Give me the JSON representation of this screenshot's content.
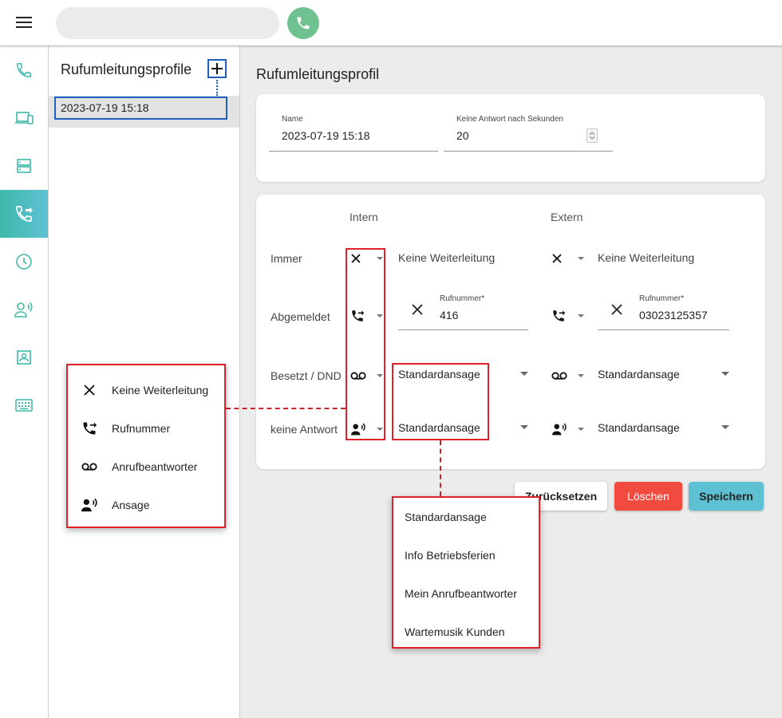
{
  "search": {
    "placeholder": "",
    "value": ""
  },
  "colors": {
    "accent": "#5ec1d3",
    "brand_green": "#6fc28f",
    "teal_icon": "#3fb9aa",
    "danger": "#f14b40",
    "highlight_red": "#e0202a",
    "focus_blue": "#1f5fbf"
  },
  "rail": {
    "items": [
      {
        "icon": "phone-icon",
        "active": false
      },
      {
        "icon": "devices-icon",
        "active": false
      },
      {
        "icon": "server-icon",
        "active": false
      },
      {
        "icon": "call-forward-icon",
        "active": true
      },
      {
        "icon": "clock-icon",
        "active": false
      },
      {
        "icon": "announcement-icon",
        "active": false
      },
      {
        "icon": "contacts-icon",
        "active": false
      },
      {
        "icon": "keyboard-icon",
        "active": false
      }
    ]
  },
  "profile_list": {
    "title": "Rufumleitungsprofile",
    "items": [
      "2023-07-19 15:18"
    ]
  },
  "content": {
    "title": "Rufumleitungsprofil",
    "name_label": "Name",
    "name_value": "2023-07-19 15:18",
    "timeout_label": "Keine Antwort nach Sekunden",
    "timeout_value": "20"
  },
  "matrix": {
    "col_intern": "Intern",
    "col_extern": "Extern",
    "rows": {
      "always": {
        "label": "Immer",
        "intern_icon": "close-icon",
        "intern_text": "Keine Weiterleitung",
        "extern_icon": "close-icon",
        "extern_text": "Keine Weiterleitung"
      },
      "logged_off": {
        "label": "Abgemeldet",
        "intern_icon": "call-forward-icon",
        "intern_number_label": "Rufnummer*",
        "intern_number": "416",
        "extern_icon": "call-forward-icon",
        "extern_number_label": "Rufnummer*",
        "extern_number": "03023125357"
      },
      "busy": {
        "label": "Besetzt / DND",
        "intern_icon": "voicemail-icon",
        "intern_select": "Standardansage",
        "extern_icon": "voicemail-icon",
        "extern_select": "Standardansage"
      },
      "no_answer": {
        "label": "keine Antwort",
        "intern_icon": "announcement-icon",
        "intern_select": "Standardansage",
        "extern_icon": "announcement-icon",
        "extern_select": "Standardansage"
      }
    }
  },
  "type_menu": {
    "items": [
      {
        "icon": "close-icon",
        "label": "Keine Weiterleitung"
      },
      {
        "icon": "call-forward-icon",
        "label": "Rufnummer"
      },
      {
        "icon": "voicemail-icon",
        "label": "Anrufbeantworter"
      },
      {
        "icon": "announcement-icon",
        "label": "Ansage"
      }
    ]
  },
  "announcement_menu": {
    "items": [
      "Standardansage",
      "Info Betriebsferien",
      "Mein Anrufbeantworter",
      "Wartemusik Kunden"
    ]
  },
  "actions": {
    "reset": "Zurücksetzen",
    "delete": "Löschen",
    "save": "Speichern"
  }
}
